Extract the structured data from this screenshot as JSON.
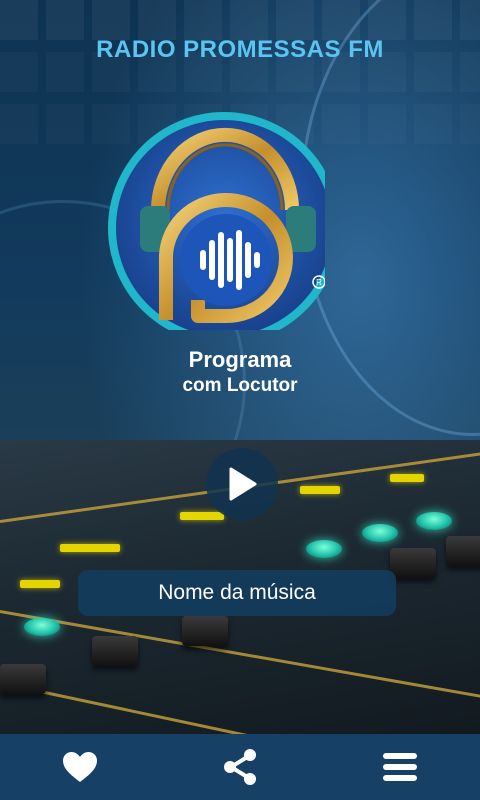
{
  "header": {
    "title": "RADIO PROMESSAS FM"
  },
  "program": {
    "line1": "Programa",
    "line2": "com Locutor"
  },
  "player": {
    "song_title": "Nome da música"
  },
  "bottom_nav": {
    "items": [
      {
        "icon": "heart-icon"
      },
      {
        "icon": "share-icon"
      },
      {
        "icon": "menu-icon"
      }
    ]
  },
  "colors": {
    "title": "#5cc4f0",
    "bar_bg": "#164066",
    "logo_blue": "#1d56b8",
    "logo_gold": "#d5a944",
    "logo_ring": "#1fb7c9"
  }
}
